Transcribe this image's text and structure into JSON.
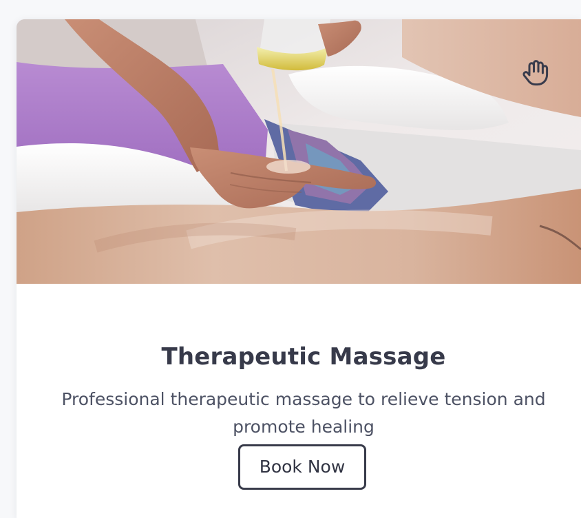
{
  "card": {
    "icon": "hand-icon",
    "title": "Therapeutic Massage",
    "description": "Professional therapeutic massage to relieve tension and promote healing",
    "button_label": "Book Now"
  },
  "colors": {
    "title": "#373a4a",
    "body": "#4d5264",
    "button_border": "#383b4a"
  }
}
